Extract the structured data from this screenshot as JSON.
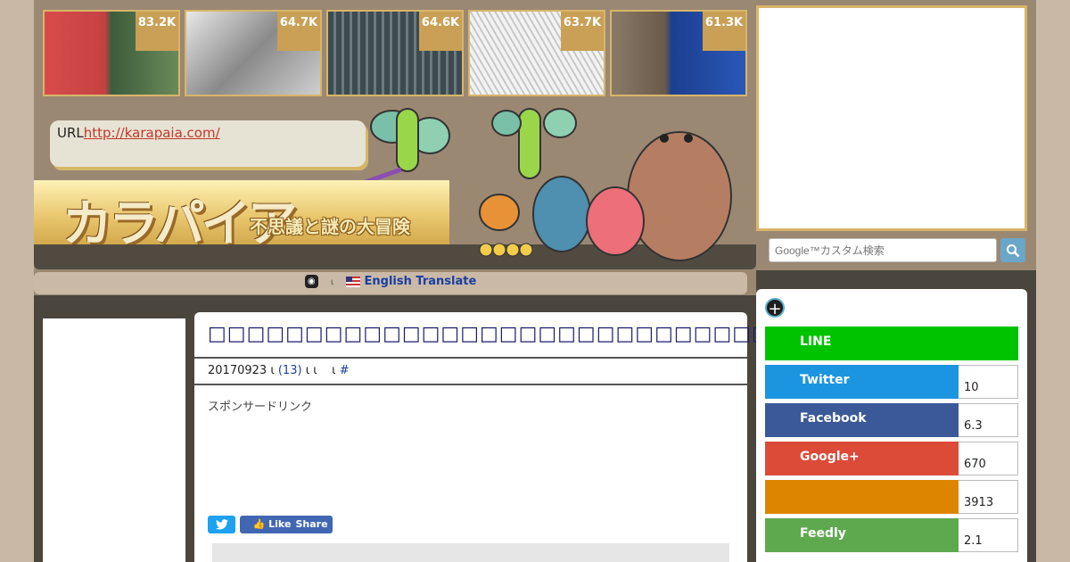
{
  "thumbnails": [
    {
      "count": "83.2K"
    },
    {
      "count": "64.7K"
    },
    {
      "count": "64.6K"
    },
    {
      "count": "63.7K"
    },
    {
      "count": "61.3K"
    }
  ],
  "header": {
    "url_label": "URL",
    "url_link": "http://karapaia.com/",
    "logo": "カラパイア",
    "tagline": "不思議と謎の大冒険"
  },
  "translate": {
    "globe": "◉",
    "separator": "ι",
    "label": "English Translate"
  },
  "article": {
    "title": "□□□□□□□□□□□□□□□□□□□□□□□□□□□□□□□□□□□□□□□",
    "date": "20170923",
    "sep1": "ι",
    "comments": "(13)",
    "sep2": "ι ι",
    "sep3": "ι",
    "hash": "#",
    "sponsor": "スポンサードリンク",
    "share": {
      "twitter": "",
      "like": "Like",
      "share": "Share"
    }
  },
  "search": {
    "placeholder": "Google™カスタム検索"
  },
  "social": [
    {
      "label": "LINE",
      "count": "",
      "color": "#00c300"
    },
    {
      "label": "Twitter",
      "count": "10",
      "color": "#1c95e0"
    },
    {
      "label": "Facebook",
      "count": "6.3",
      "color": "#3b5998"
    },
    {
      "label": "Google+",
      "count": "670",
      "color": "#dc4a38"
    },
    {
      "label": "",
      "count": "3913",
      "color": "#dd8500"
    },
    {
      "label": "Feedly",
      "count": "2.1",
      "color": "#5ea94e"
    }
  ]
}
